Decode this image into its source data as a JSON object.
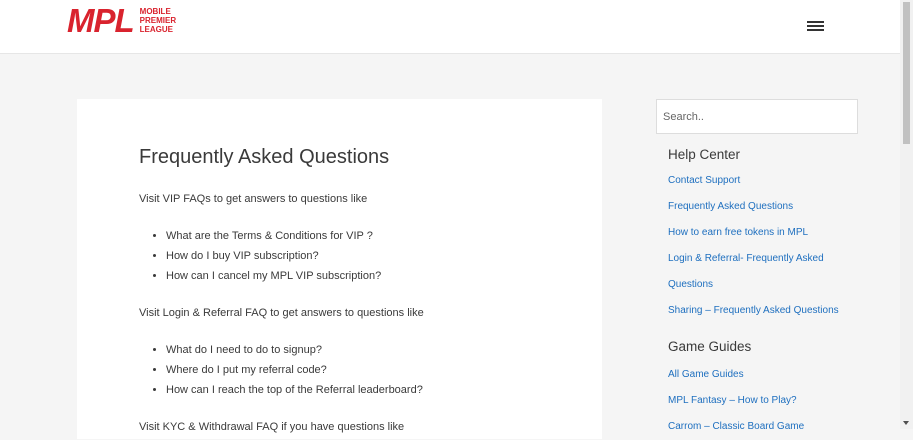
{
  "header": {
    "logo_mark": "MPL",
    "logo_lines": [
      "MOBILE",
      "PREMIER",
      "LEAGUE"
    ],
    "menu_icon": "hamburger-menu-icon",
    "brand_color": "#d9232e"
  },
  "main": {
    "title": "Frequently Asked Questions",
    "sections": [
      {
        "intro": "Visit VIP FAQs to get answers to questions like",
        "questions": [
          "What are the Terms & Conditions for VIP ?",
          "How do I buy VIP subscription?",
          "How can I cancel my MPL VIP subscription?"
        ]
      },
      {
        "intro": "Visit Login & Referral FAQ to get answers to questions like",
        "questions": [
          "What do I need to do to signup?",
          "Where do I put my referral code?",
          "How can I reach the top of the Referral leaderboard?"
        ]
      },
      {
        "intro": "Visit KYC & Withdrawal FAQ if you have questions like"
      }
    ]
  },
  "sidebar": {
    "search_placeholder": "Search..",
    "help_center": {
      "title": "Help Center",
      "links": [
        "Contact Support",
        "Frequently Asked Questions",
        "How to earn free tokens in MPL",
        "Login & Referral- Frequently Asked",
        "Questions",
        "Sharing – Frequently Asked Questions"
      ]
    },
    "game_guides": {
      "title": "Game Guides",
      "links": [
        "All Game Guides",
        "MPL Fantasy – How to Play?",
        "Carrom – Classic Board Game"
      ]
    },
    "link_color": "#1e6fbf"
  }
}
